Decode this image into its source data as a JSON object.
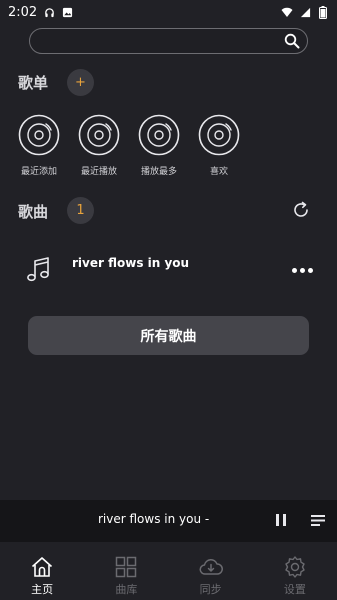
{
  "status_bar": {
    "time": "2:02",
    "left_icons": [
      "headphones-icon",
      "image-icon"
    ],
    "right_icons": [
      "wifi-icon",
      "signal-icon",
      "battery-icon"
    ]
  },
  "search": {
    "value": "",
    "placeholder": ""
  },
  "playlists": {
    "title": "歌单",
    "add_label": "+",
    "items": [
      {
        "label": "最近添加",
        "icon": "disc-icon"
      },
      {
        "label": "最近播放",
        "icon": "disc-icon"
      },
      {
        "label": "播放最多",
        "icon": "disc-icon"
      },
      {
        "label": "喜欢",
        "icon": "disc-icon"
      }
    ]
  },
  "songs": {
    "title": "歌曲",
    "count": "1",
    "items": [
      {
        "title": "river flows in you",
        "icon": "music-note-icon"
      }
    ],
    "all_songs_label": "所有歌曲"
  },
  "player": {
    "now_playing": "river flows in you -"
  },
  "tabs": [
    {
      "label": "主页",
      "icon": "home-icon",
      "active": true
    },
    {
      "label": "曲库",
      "icon": "library-icon",
      "active": false
    },
    {
      "label": "同步",
      "icon": "cloud-sync-icon",
      "active": false
    },
    {
      "label": "设置",
      "icon": "gear-icon",
      "active": false
    }
  ],
  "colors": {
    "background": "#212126",
    "accent": "#e8a33c",
    "button": "#45454b",
    "player_bar": "#151518",
    "inactive_tab": "#6b6b70"
  }
}
